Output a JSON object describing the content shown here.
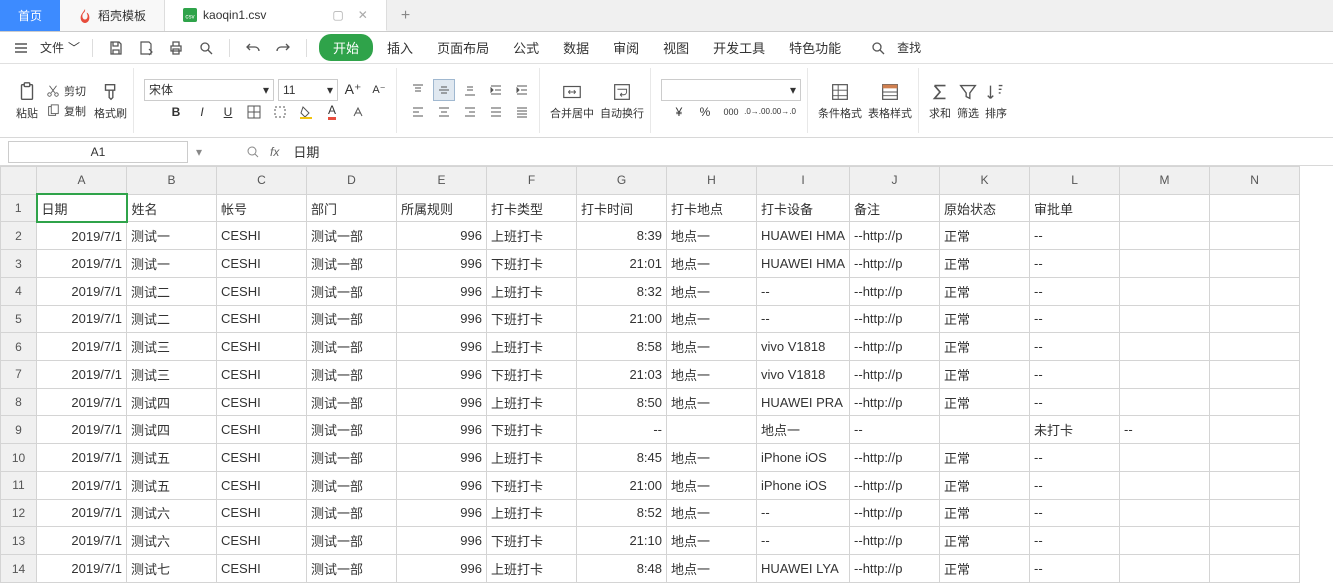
{
  "tabs": {
    "home": "首页",
    "t1": "稻壳模板",
    "t2": "kaoqin1.csv"
  },
  "menubar": {
    "file": "文件",
    "items": [
      "开始",
      "插入",
      "页面布局",
      "公式",
      "数据",
      "审阅",
      "视图",
      "开发工具",
      "特色功能"
    ],
    "search": "查找"
  },
  "ribbon": {
    "paste": "粘贴",
    "cut": "剪切",
    "copy": "复制",
    "fmtpaint": "格式刷",
    "font_name": "宋体",
    "font_size": "11",
    "merge": "合并居中",
    "wrap": "自动换行",
    "condfmt": "条件格式",
    "tblstyle": "表格样式",
    "sum": "求和",
    "filter": "筛选",
    "sort": "排序"
  },
  "namebox": "A1",
  "formula_value": "日期",
  "columns": [
    "A",
    "B",
    "C",
    "D",
    "E",
    "F",
    "G",
    "H",
    "I",
    "J",
    "K",
    "L",
    "M",
    "N"
  ],
  "chart_data": {
    "type": "table",
    "headers": [
      "日期",
      "姓名",
      "帐号",
      "部门",
      "所属规则",
      "打卡类型",
      "打卡时间",
      "打卡地点",
      "打卡设备",
      "备注",
      "原始状态",
      "审批单"
    ],
    "rows": [
      [
        "2019/7/1",
        "测试一",
        "CESHI",
        "测试一部",
        "996",
        "上班打卡",
        "8:39",
        "地点一",
        "HUAWEI HMA",
        "--http://p",
        "正常",
        "--"
      ],
      [
        "2019/7/1",
        "测试一",
        "CESHI",
        "测试一部",
        "996",
        "下班打卡",
        "21:01",
        "地点一",
        "HUAWEI HMA",
        "--http://p",
        "正常",
        "--"
      ],
      [
        "2019/7/1",
        "测试二",
        "CESHI",
        "测试一部",
        "996",
        "上班打卡",
        "8:32",
        "地点一",
        "--",
        "--http://p",
        "正常",
        "--"
      ],
      [
        "2019/7/1",
        "测试二",
        "CESHI",
        "测试一部",
        "996",
        "下班打卡",
        "21:00",
        "地点一",
        "--",
        "--http://p",
        "正常",
        "--"
      ],
      [
        "2019/7/1",
        "测试三",
        "CESHI",
        "测试一部",
        "996",
        "上班打卡",
        "8:58",
        "地点一",
        "vivo V1818",
        "--http://p",
        "正常",
        "--"
      ],
      [
        "2019/7/1",
        "测试三",
        "CESHI",
        "测试一部",
        "996",
        "下班打卡",
        "21:03",
        "地点一",
        "vivo V1818",
        "--http://p",
        "正常",
        "--"
      ],
      [
        "2019/7/1",
        "测试四",
        "CESHI",
        "测试一部",
        "996",
        "上班打卡",
        "8:50",
        "地点一",
        "HUAWEI PRA",
        "--http://p",
        "正常",
        "--"
      ],
      [
        "2019/7/1",
        "测试四",
        "CESHI",
        "测试一部",
        "996",
        "下班打卡",
        "--",
        "",
        "地点一",
        "--",
        "",
        "未打卡",
        "--"
      ],
      [
        "2019/7/1",
        "测试五",
        "CESHI",
        "测试一部",
        "996",
        "上班打卡",
        "8:45",
        "地点一",
        "iPhone iOS",
        "--http://p",
        "正常",
        "--"
      ],
      [
        "2019/7/1",
        "测试五",
        "CESHI",
        "测试一部",
        "996",
        "下班打卡",
        "21:00",
        "地点一",
        "iPhone iOS",
        "--http://p",
        "正常",
        "--"
      ],
      [
        "2019/7/1",
        "测试六",
        "CESHI",
        "测试一部",
        "996",
        "上班打卡",
        "8:52",
        "地点一",
        "--",
        "--http://p",
        "正常",
        "--"
      ],
      [
        "2019/7/1",
        "测试六",
        "CESHI",
        "测试一部",
        "996",
        "下班打卡",
        "21:10",
        "地点一",
        "--",
        "--http://p",
        "正常",
        "--"
      ],
      [
        "2019/7/1",
        "测试七",
        "CESHI",
        "测试一部",
        "996",
        "上班打卡",
        "8:48",
        "地点一",
        "HUAWEI LYA",
        "--http://p",
        "正常",
        "--"
      ]
    ]
  }
}
